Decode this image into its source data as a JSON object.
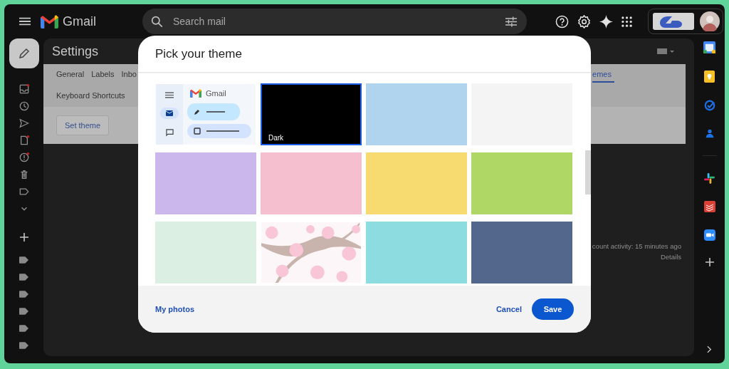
{
  "topbar": {
    "app_name": "Gmail",
    "search": {
      "placeholder": "Search mail"
    }
  },
  "left_nav": [
    {
      "kind": "inbox",
      "dot": true
    },
    {
      "kind": "clock",
      "dot": false
    },
    {
      "kind": "send",
      "dot": false
    },
    {
      "kind": "file",
      "dot": true
    },
    {
      "kind": "alert",
      "dot": true
    },
    {
      "kind": "trash",
      "dot": false
    },
    {
      "kind": "label",
      "dot": false
    },
    {
      "kind": "more",
      "dot": false
    }
  ],
  "label_count_icons": [
    {
      "kind": "label"
    },
    {
      "kind": "label"
    },
    {
      "kind": "label"
    },
    {
      "kind": "label"
    },
    {
      "kind": "label"
    },
    {
      "kind": "label"
    }
  ],
  "settings": {
    "title": "Settings",
    "tabs_left": [
      {
        "label": "General",
        "selected": false
      },
      {
        "label": "Labels",
        "selected": false
      },
      {
        "label": "Inbo",
        "selected": false
      }
    ],
    "tabs_right": [
      {
        "label": "emes",
        "selected": true
      }
    ],
    "tabs_second_row": [
      {
        "label": "Keyboard Shortcuts",
        "selected": false
      }
    ],
    "set_theme_button": "Set theme",
    "activity": "count activity: 15 minutes ago",
    "details_link": "Details"
  },
  "right_rail": [
    {
      "kind": "calendar"
    },
    {
      "kind": "keep"
    },
    {
      "kind": "tasks"
    },
    {
      "kind": "contacts"
    },
    {
      "kind": "divider"
    },
    {
      "kind": "slack"
    },
    {
      "kind": "todoist"
    },
    {
      "kind": "zoom"
    },
    {
      "kind": "add"
    }
  ],
  "dialog": {
    "title": "Pick your theme",
    "themes": [
      {
        "kind": "default",
        "label": "Gmail",
        "selected": false
      },
      {
        "kind": "color",
        "color": "#000000",
        "label": "Dark",
        "selected": true
      },
      {
        "kind": "color",
        "color": "#b1d4ee",
        "selected": false
      },
      {
        "kind": "color",
        "color": "#f4f4f4",
        "selected": false
      },
      {
        "kind": "color",
        "color": "#cbb7ec",
        "selected": false
      },
      {
        "kind": "color",
        "color": "#f5bfd0",
        "selected": false
      },
      {
        "kind": "color",
        "color": "#f7da70",
        "selected": false
      },
      {
        "kind": "color",
        "color": "#afd765",
        "selected": false
      },
      {
        "kind": "color",
        "color": "#dbefe2",
        "selected": false
      },
      {
        "kind": "picture",
        "selected": false
      },
      {
        "kind": "color",
        "color": "#8ddcdf",
        "selected": false
      },
      {
        "kind": "color",
        "color": "#53668b",
        "selected": false
      }
    ],
    "my_photos": "My photos",
    "cancel": "Cancel",
    "save": "Save"
  }
}
